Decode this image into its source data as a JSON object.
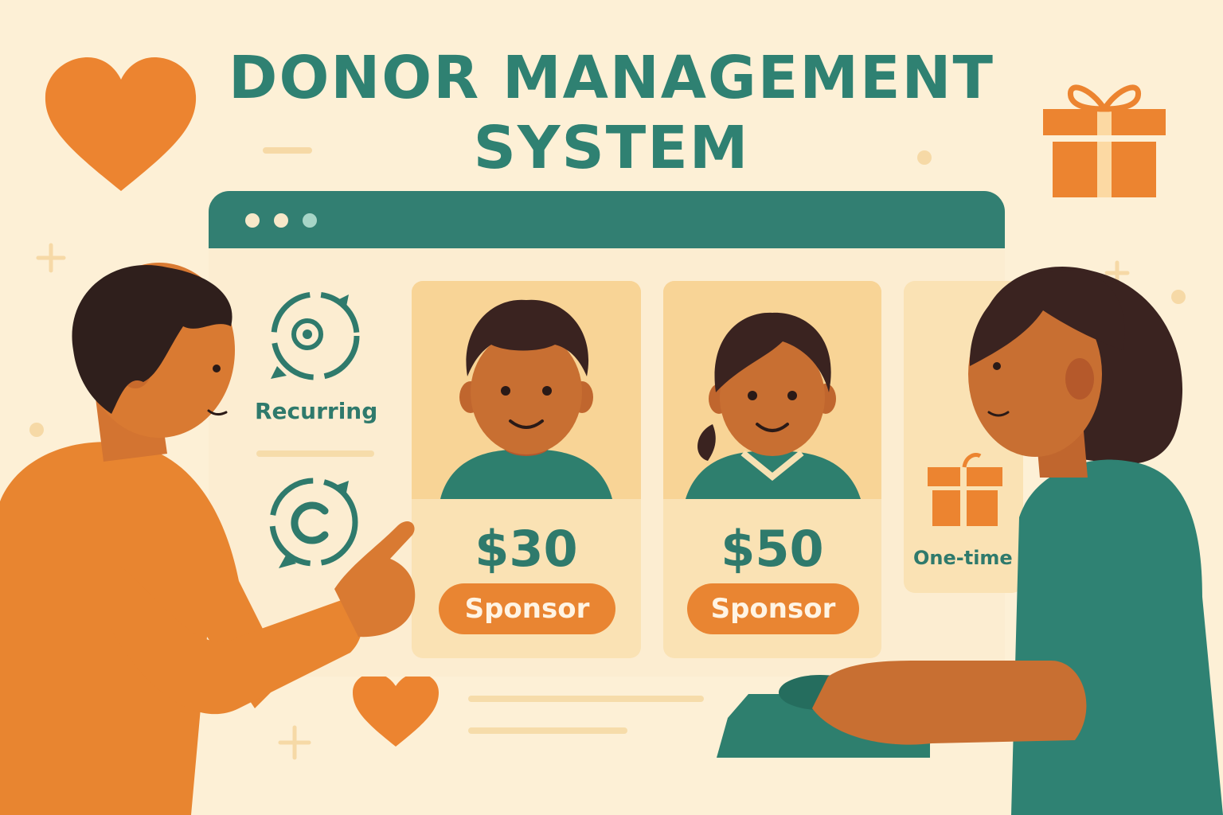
{
  "title": {
    "line1": "DONOR MANAGEMENT",
    "line2": "SYSTEM"
  },
  "options": {
    "recurring_label": "Recurring",
    "one_time_label": "One-time"
  },
  "cards": [
    {
      "price": "$30",
      "button": "Sponsor"
    },
    {
      "price": "$50",
      "button": "Sponsor"
    }
  ],
  "colors": {
    "teal": "#327f72",
    "orange": "#e98532",
    "background": "#fdf0d6"
  },
  "icons": [
    "heart-icon",
    "gift-icon",
    "recurring-cycle-icon",
    "sync-icon",
    "plus-icon"
  ]
}
